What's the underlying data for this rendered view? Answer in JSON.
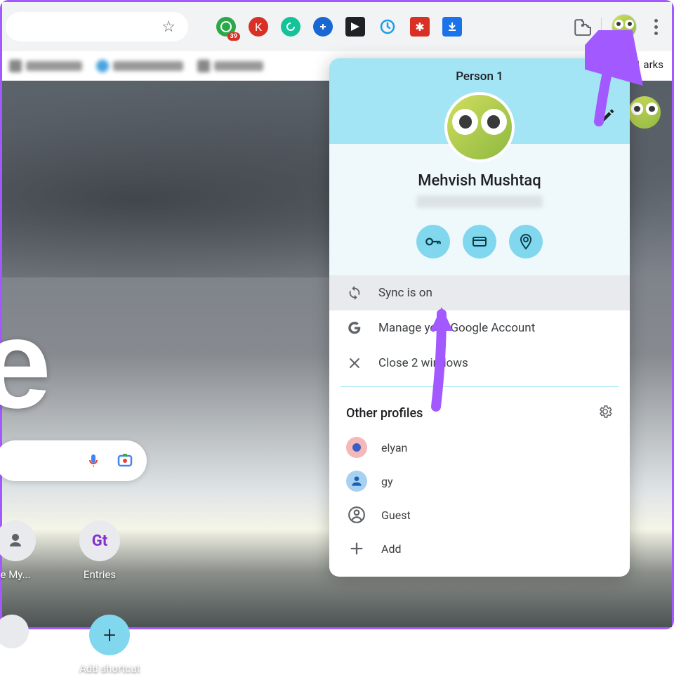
{
  "toolbar": {
    "ext_badge": "39",
    "bookmarks_right": "arks"
  },
  "ntp": {
    "shortcut1_label": "e My...",
    "shortcut2_label": "Entries",
    "shortcut3_label": "Add shortcut"
  },
  "profile": {
    "header_title": "Person 1",
    "name": "Mehvish Mushtaq",
    "rows": {
      "sync": "Sync is on",
      "manage": "Manage your Google Account",
      "close": "Close 2 windows"
    },
    "other_title": "Other profiles",
    "others": [
      {
        "label": "elyan"
      },
      {
        "label": "gy"
      },
      {
        "label": "Guest"
      },
      {
        "label": "Add"
      }
    ]
  }
}
